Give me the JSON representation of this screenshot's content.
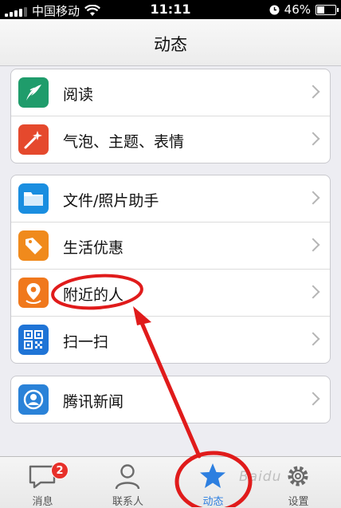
{
  "status_bar": {
    "carrier": "中国移动",
    "time": "11:11",
    "battery": "46%",
    "battery_level": 0.46
  },
  "nav": {
    "title": "动态"
  },
  "groups": [
    {
      "items": [
        {
          "label": "阅读",
          "icon": "feather-icon",
          "color": "#1f9c6b"
        },
        {
          "label": "气泡、主题、表情",
          "icon": "magic-wand-icon",
          "color": "#e5492d"
        }
      ]
    },
    {
      "items": [
        {
          "label": "文件/照片助手",
          "icon": "folder-icon",
          "color": "#1a8ee0"
        },
        {
          "label": "生活优惠",
          "icon": "price-tag-icon",
          "color": "#f08a1c"
        },
        {
          "label": "附近的人",
          "icon": "location-pin-icon",
          "color": "#f0781c"
        },
        {
          "label": "扫一扫",
          "icon": "qr-code-icon",
          "color": "#1f74d6"
        }
      ]
    },
    {
      "items": [
        {
          "label": "腾讯新闻",
          "icon": "news-icon",
          "color": "#2a82d8"
        }
      ]
    }
  ],
  "tabbar": {
    "tabs": [
      {
        "label": "消息",
        "icon": "chat-bubble-icon",
        "badge": "2"
      },
      {
        "label": "联系人",
        "icon": "contacts-icon"
      },
      {
        "label": "动态",
        "icon": "star-icon",
        "active": true
      },
      {
        "label": "设置",
        "icon": "gear-icon"
      }
    ]
  },
  "watermark": "Baidu",
  "colors": {
    "annotation_red": "#e01b1b",
    "active_tab_blue": "#2d7fe0",
    "badge_red": "#e7302a"
  }
}
